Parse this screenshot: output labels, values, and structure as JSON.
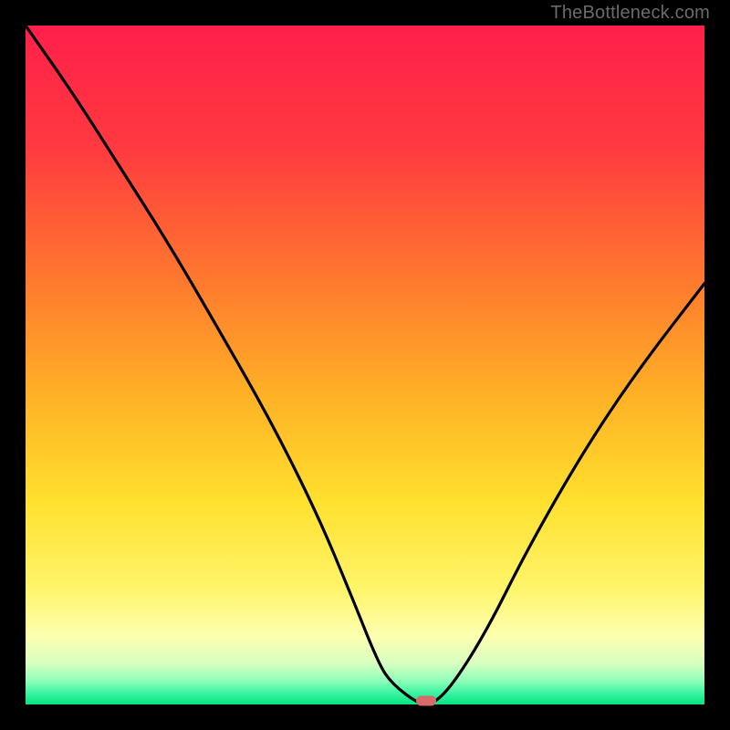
{
  "watermark": {
    "text": "TheBottleneck.com"
  },
  "chart_data": {
    "type": "line",
    "title": "",
    "xlabel": "",
    "ylabel": "",
    "xlim": [
      0,
      100
    ],
    "ylim": [
      0,
      100
    ],
    "series": [
      {
        "name": "bottleneck-curve",
        "x": [
          0,
          7,
          14,
          21,
          28,
          36,
          43,
          48,
          52,
          54,
          58,
          60,
          63,
          68,
          74,
          82,
          90,
          100
        ],
        "values": [
          100,
          90,
          79,
          68,
          56,
          42,
          28,
          16,
          6,
          3,
          0,
          0,
          3,
          11,
          23,
          37,
          49,
          62
        ]
      }
    ],
    "marker": {
      "x": 59,
      "y": 0.5,
      "label": "optimal-point"
    },
    "gradient_stops": [
      {
        "offset": 0.0,
        "color": "#ff1f4b"
      },
      {
        "offset": 0.18,
        "color": "#ff3a3f"
      },
      {
        "offset": 0.38,
        "color": "#ff7a2e"
      },
      {
        "offset": 0.55,
        "color": "#ffb326"
      },
      {
        "offset": 0.7,
        "color": "#ffe02e"
      },
      {
        "offset": 0.83,
        "color": "#fff56a"
      },
      {
        "offset": 0.9,
        "color": "#fcffb0"
      },
      {
        "offset": 0.94,
        "color": "#d7ffc0"
      },
      {
        "offset": 0.965,
        "color": "#8fffb9"
      },
      {
        "offset": 0.985,
        "color": "#34f3a0"
      },
      {
        "offset": 1.0,
        "color": "#08e37f"
      }
    ]
  }
}
